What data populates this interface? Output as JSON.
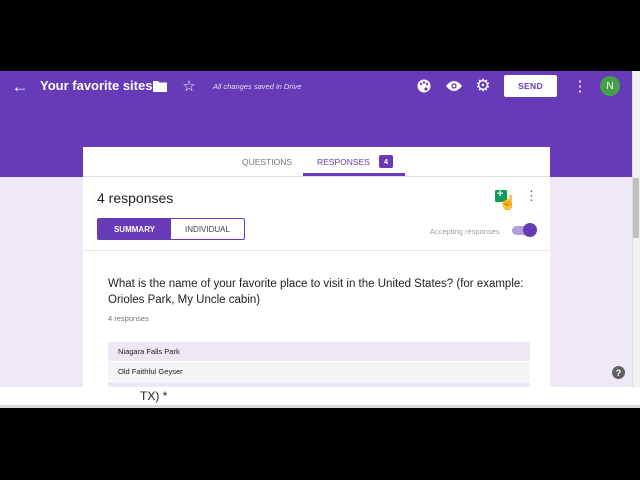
{
  "header": {
    "title": "Your favorite sites",
    "saved_status": "All changes saved in Drive",
    "send_label": "SEND",
    "avatar_initial": "N"
  },
  "tabs": {
    "questions_label": "QUESTIONS",
    "responses_label": "RESPONSES",
    "responses_count": "4"
  },
  "summary": {
    "response_count_text": "4 responses",
    "summary_label": "SUMMARY",
    "individual_label": "INDIVIDUAL",
    "accepting_label": "Accepting responses",
    "accepting_on": true
  },
  "question": {
    "text": "What is the name of your favorite place to visit in the United States? (for example: Orioles Park, My Uncle cabin)",
    "count_text": "4 responses",
    "answers": [
      "Niagara Falls Park",
      "Old Faithful Geyser",
      ""
    ]
  },
  "underlying_window": {
    "text": "TX) *"
  },
  "colors": {
    "accent": "#673ab7",
    "sheets_green": "#0f9d58",
    "avatar_green": "#43a047"
  }
}
